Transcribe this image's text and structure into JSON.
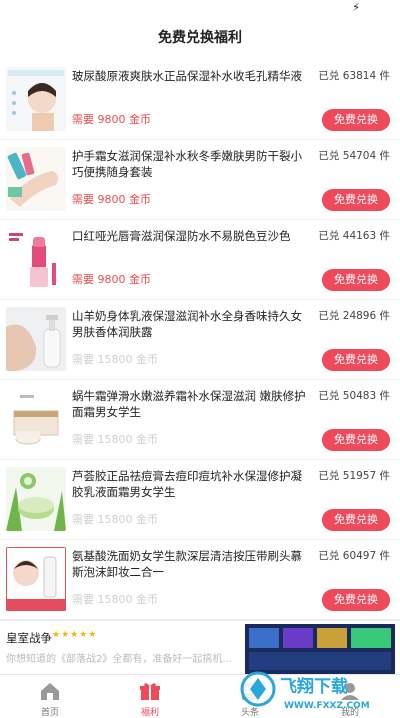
{
  "header": {
    "title": "免费兑换福利"
  },
  "products": [
    {
      "title": "玻尿酸原液爽肤水正品保湿补水收毛孔精华液",
      "sold": "已兑 63814 件",
      "price": "需要 9800 金币",
      "button": "免费兑换",
      "thumb": "face-serum"
    },
    {
      "title": "护手霜女滋润保湿补水秋冬季嫩肤男防干裂小巧便携随身套装",
      "sold": "已兑 54704 件",
      "price": "需要 9800 金币",
      "button": "免费兑换",
      "thumb": "hand-cream"
    },
    {
      "title": "口红哑光唇膏滋润保湿防水不易脱色豆沙色",
      "sold": "已兑 44163 件",
      "price": "需要 9800 金币",
      "button": "免费兑换",
      "thumb": "lipstick"
    },
    {
      "title": "山羊奶身体乳液保湿滋润补水全身香味持久女男肤香体润肤露",
      "sold": "已兑 24896 件",
      "price": "需要 15800 金币",
      "button": "免费兑换",
      "thumb": "body-lotion"
    },
    {
      "title": "蜗牛霜弹滑水嫩滋养霜补水保湿滋润 嫩肤修护面霜男女学生",
      "sold": "已兑 50483 件",
      "price": "需要 15800 金币",
      "button": "免费兑换",
      "thumb": "snail-cream"
    },
    {
      "title": "芦荟胶正品祛痘膏去痘印痘坑补水保湿修护凝胶乳液面霜男女学生",
      "sold": "已兑 51957 件",
      "price": "需要 15800 金币",
      "button": "免费兑换",
      "thumb": "aloe-gel"
    },
    {
      "title": "氨基酸洗面奶女学生款深层清洁按压带刷头慕斯泡沫卸妆二合一",
      "sold": "已兑 60497 件",
      "price": "需要 15800 金币",
      "button": "免费兑换",
      "thumb": "cleanser"
    }
  ],
  "ad": {
    "title": "皇室战争",
    "stars": "★★★★★",
    "description": "你想知道的《部落战2》全都有，准备好一起搞机..."
  },
  "tabs": [
    {
      "label": "首页",
      "icon": "home-icon",
      "active": false
    },
    {
      "label": "福利",
      "icon": "gift-icon",
      "active": true
    },
    {
      "label": "头条",
      "icon": "news-icon",
      "active": false
    },
    {
      "label": "我的",
      "icon": "profile-icon",
      "active": false
    }
  ],
  "watermark": {
    "text": "飞翔下载",
    "url": "WWW.FXXZ.COM"
  },
  "colors": {
    "accent": "#ef4a5a",
    "price": "#e94d4d",
    "faded_price": "#cfcfcf"
  }
}
